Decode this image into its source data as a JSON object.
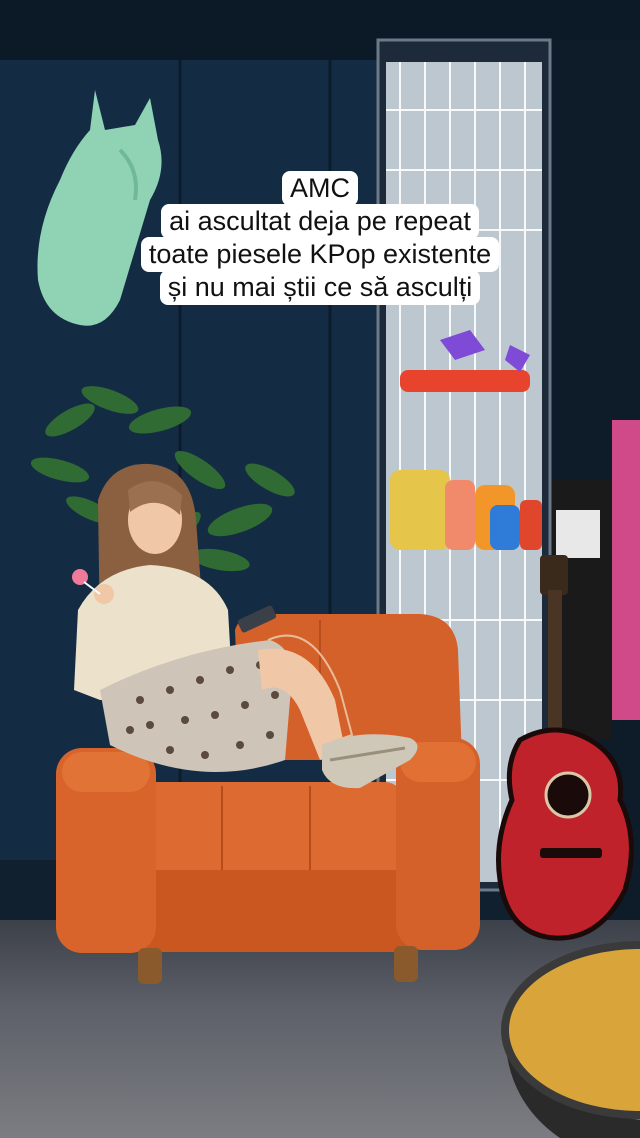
{
  "caption": {
    "lines": [
      "AMC",
      "ai ascultat deja pe repeat",
      "toate piesele KPop existente",
      "și nu mai știi ce să asculți"
    ]
  },
  "colors": {
    "wall": "#13304b",
    "armchair": "#d9642a",
    "horse_head": "#8fd3b4",
    "guitar": "#c0222b",
    "caption_bg": "#ffffff",
    "caption_text": "#111111"
  },
  "scene": {
    "icons": [
      "horse-head-wall-decor",
      "plant-icon",
      "armchair",
      "guitar-icon",
      "led-light-panel",
      "person-figure",
      "table-edge"
    ]
  }
}
